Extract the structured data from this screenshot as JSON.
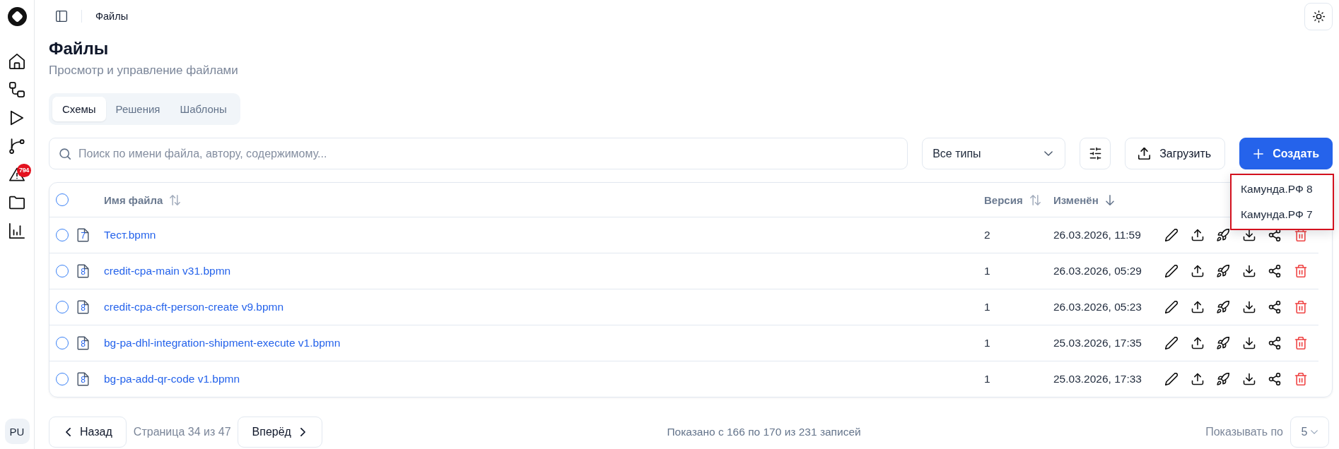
{
  "sidebar": {
    "alert_count": "794",
    "avatar": "PU"
  },
  "topbar": {
    "breadcrumb": "Файлы"
  },
  "header": {
    "title": "Файлы",
    "subtitle": "Просмотр и управление файлами"
  },
  "tabs": [
    {
      "label": "Схемы",
      "selected": true
    },
    {
      "label": "Решения",
      "selected": false
    },
    {
      "label": "Шаблоны",
      "selected": false
    }
  ],
  "toolbar": {
    "search": {
      "placeholder": "Поиск по имени файла, автору, содержимому..."
    },
    "type_filter": {
      "value": "Все типы"
    },
    "upload_button": "Загрузить",
    "create_button": "Создать",
    "create_menu": {
      "highlighted": true,
      "items": [
        {
          "label": "Камунда.РФ 8"
        },
        {
          "label": "Камунда.РФ 7"
        }
      ]
    }
  },
  "table": {
    "select_all": {
      "checked": false
    },
    "columns": [
      {
        "label": "Имя файла",
        "sort_active": false
      },
      {
        "label": "Версия",
        "sort_active": false
      },
      {
        "label": "Изменён",
        "sort_active": true
      }
    ],
    "rows": [
      {
        "selected": false,
        "engine_version": "7",
        "name": "Тест.bpmn",
        "version": "2",
        "modified": "26.03.2026, 11:59"
      },
      {
        "selected": false,
        "engine_version": "8",
        "name": "credit-cpa-main v31.bpmn",
        "version": "1",
        "modified": "26.03.2026, 05:29"
      },
      {
        "selected": false,
        "engine_version": "8",
        "name": "credit-cpa-cft-person-create v9.bpmn",
        "version": "1",
        "modified": "26.03.2026, 05:23"
      },
      {
        "selected": false,
        "engine_version": "8",
        "name": "bg-pa-dhl-integration-shipment-execute v1.bpmn",
        "version": "1",
        "modified": "25.03.2026, 17:35"
      },
      {
        "selected": false,
        "engine_version": "8",
        "name": "bg-pa-add-qr-code v1.bpmn",
        "version": "1",
        "modified": "25.03.2026, 17:33"
      }
    ]
  },
  "pagination": {
    "previous": "Назад",
    "page_info": "Страница 34 из 47",
    "next": "Вперёд",
    "summary": "Показано с 166 по 170 из 231 записей",
    "page_size_label": "Показывать по",
    "page_size": "5"
  }
}
